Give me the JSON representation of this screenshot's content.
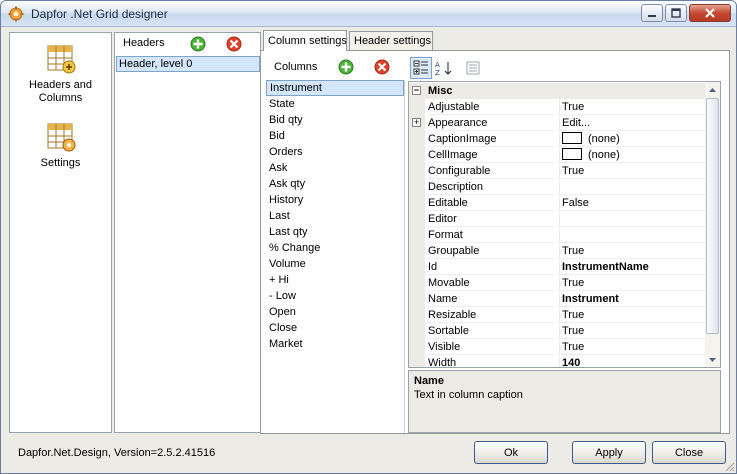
{
  "window": {
    "title": "Dapfor .Net Grid designer",
    "title_buttons": [
      "minimize-icon",
      "maximize-icon",
      "close-icon"
    ]
  },
  "nav": {
    "items": [
      {
        "label": "Headers and Columns",
        "icon": "grid-headers-icon"
      },
      {
        "label": "Settings",
        "icon": "grid-settings-icon"
      }
    ]
  },
  "headers_panel": {
    "label": "Headers",
    "rows": [
      "Header, level 0"
    ]
  },
  "tabs": [
    {
      "label": "Column settings",
      "active": true
    },
    {
      "label": "Header settings",
      "active": false
    }
  ],
  "columns_panel": {
    "label": "Columns",
    "items": [
      "Instrument",
      "State",
      "Bid qty",
      "Bid",
      "Orders",
      "Ask",
      "Ask qty",
      "History",
      "Last",
      "Last qty",
      "% Change",
      "Volume",
      "+ Hi",
      "- Low",
      "Open",
      "Close",
      "Market"
    ],
    "selected": "Instrument"
  },
  "property_grid": {
    "category": "Misc",
    "rows": [
      {
        "name": "Adjustable",
        "value": "True",
        "bold": false
      },
      {
        "name": "Appearance",
        "value": "Edit...",
        "bold": false,
        "expandable": true
      },
      {
        "name": "CaptionImage",
        "value": "(none)",
        "bold": false,
        "swatch": true
      },
      {
        "name": "CellImage",
        "value": "(none)",
        "bold": false,
        "swatch": true
      },
      {
        "name": "Configurable",
        "value": "True",
        "bold": false
      },
      {
        "name": "Description",
        "value": "",
        "bold": false
      },
      {
        "name": "Editable",
        "value": "False",
        "bold": false
      },
      {
        "name": "Editor",
        "value": "",
        "bold": false
      },
      {
        "name": "Format",
        "value": "",
        "bold": false
      },
      {
        "name": "Groupable",
        "value": "True",
        "bold": false
      },
      {
        "name": "Id",
        "value": "InstrumentName",
        "bold": true
      },
      {
        "name": "Movable",
        "value": "True",
        "bold": false
      },
      {
        "name": "Name",
        "value": "Instrument",
        "bold": true
      },
      {
        "name": "Resizable",
        "value": "True",
        "bold": false
      },
      {
        "name": "Sortable",
        "value": "True",
        "bold": false
      },
      {
        "name": "Visible",
        "value": "True",
        "bold": false
      },
      {
        "name": "Width",
        "value": "140",
        "bold": true
      }
    ],
    "description_title": "Name",
    "description_text": "Text in column caption"
  },
  "footer": {
    "version": "Dapfor.Net.Design,  Version=2.5.2.41516",
    "ok_label": "Ok",
    "apply_label": "Apply",
    "close_label": "Close"
  }
}
